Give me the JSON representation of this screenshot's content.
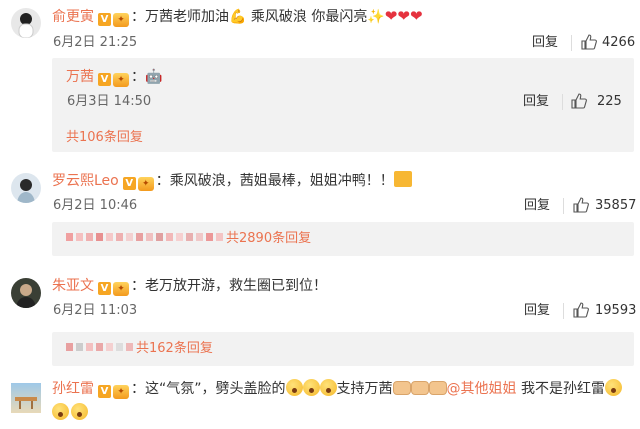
{
  "colors": {
    "username": "#eb7350",
    "heart": "#e5323e",
    "more_link": "#eb7350"
  },
  "comments": [
    {
      "user": "俞更寅",
      "text_a": "：万茜老师加油",
      "text_b": " 乘风破浪 你最闪亮",
      "emoji": [
        "flexed-biceps-emoji",
        "sparkles-emoji",
        "heart-emoji",
        "heart-emoji",
        "heart-emoji"
      ],
      "time": "6月2日 21:25",
      "reply": "回复",
      "likes": "4266",
      "sub": {
        "user": "万茜",
        "text": "：",
        "emoji": [
          "robot-face-emoji"
        ],
        "time": "6月3日 14:50",
        "reply": "回复",
        "likes": "225",
        "more": "共106条回复"
      }
    },
    {
      "user": "罗云熙Leo",
      "text": "：乘风破浪，茜姐最棒，姐姐冲鸭！！",
      "emoji": [
        "sticker-emoji"
      ],
      "time": "6月2日 10:46",
      "reply": "回复",
      "likes": "35857",
      "more": "共2890条回复"
    },
    {
      "user": "朱亚文",
      "text": "：老万放开游，救生圈已到位！",
      "time": "6月2日 11:03",
      "reply": "回复",
      "likes": "19593",
      "more": "共162条回复"
    },
    {
      "user": "孙红雷",
      "text_a": "：这“气氛”，劈头盖脸的",
      "text_b": "支持万茜",
      "mention": "@其他姐姐",
      "text_c": " 我不是孙红雷",
      "emoji": [
        "flushed-face-emoji",
        "fist-emoji",
        "sweat-face-emoji"
      ]
    }
  ]
}
